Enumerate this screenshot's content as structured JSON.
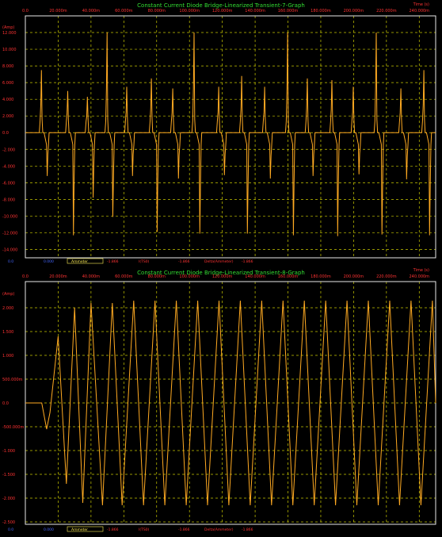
{
  "chart_data": [
    {
      "type": "line",
      "title": "Constant Current Diode Bridge-Linearized Transient-7-Graph",
      "xlabel": "Time (s)",
      "ylabel": "(Amp)",
      "x_ticks": [
        "0.0",
        "20.000m",
        "40.000m",
        "60.000m",
        "80.000m",
        "100.000m",
        "120.000m",
        "140.000m",
        "160.000m",
        "180.000m",
        "200.000m",
        "220.000m",
        "240.000m"
      ],
      "y_ticks": [
        "12.000",
        "10.000",
        "8.000",
        "6.000",
        "4.000",
        "2.000",
        "0.0",
        "-2.000",
        "-4.000",
        "-6.000",
        "-8.000",
        "-10.000",
        "-12.000",
        "-14.000"
      ],
      "ylim": [
        -15,
        14
      ],
      "xlim": [
        0,
        250
      ],
      "grid": true,
      "footer": {
        "left_value": "0.0",
        "x_readout": "0.000",
        "legend_box": "Ammeter",
        "readout1": "-1.866",
        "label2": "I(TS0)",
        "readout2": "-1.866",
        "label3": "Delta(Ammeter)",
        "readout3": "-1.866"
      },
      "series": [
        {
          "color": "#ffaa22",
          "spikes": [
            {
              "t": 10,
              "pos": 7.5,
              "neg": -5.2
            },
            {
              "t": 26,
              "pos": 5.0,
              "neg": -12.3
            },
            {
              "t": 38,
              "pos": 4.3,
              "neg": -7.8
            },
            {
              "t": 50,
              "pos": 12.0,
              "neg": -10.1
            },
            {
              "t": 62,
              "pos": 5.5,
              "neg": -5.2
            },
            {
              "t": 77,
              "pos": 6.5,
              "neg": -11.9
            },
            {
              "t": 90,
              "pos": 5.3,
              "neg": -5.5
            },
            {
              "t": 103,
              "pos": 12.0,
              "neg": -12.1
            },
            {
              "t": 118,
              "pos": 5.5,
              "neg": -5.1
            },
            {
              "t": 132,
              "pos": 6.8,
              "neg": -12.1
            },
            {
              "t": 146,
              "pos": 5.5,
              "neg": -5.5
            },
            {
              "t": 160,
              "pos": 12.0,
              "neg": -12.3
            },
            {
              "t": 172,
              "pos": 6.5,
              "neg": -5.2
            },
            {
              "t": 187,
              "pos": 6.3,
              "neg": -12.4
            },
            {
              "t": 200,
              "pos": 5.5,
              "neg": -5.0
            },
            {
              "t": 214,
              "pos": 12.0,
              "neg": -12.2
            },
            {
              "t": 229,
              "pos": 5.3,
              "neg": -5.6
            },
            {
              "t": 243,
              "pos": 7.5,
              "neg": -12.3
            }
          ]
        }
      ]
    },
    {
      "type": "line",
      "title": "Constant Current Diode Bridge-Linearized Transient-8-Graph",
      "xlabel": "Time (s)",
      "ylabel": "(Amp)",
      "x_ticks": [
        "0.0",
        "20.000m",
        "40.000m",
        "60.000m",
        "80.000m",
        "100.000m",
        "120.000m",
        "140.000m",
        "160.000m",
        "180.000m",
        "200.000m",
        "220.000m",
        "240.000m"
      ],
      "y_ticks": [
        "2.000",
        "1.500",
        "1.000",
        "500.000m",
        "0.0",
        "-500.000m",
        "-1.000",
        "-1.500",
        "-2.000",
        "-2.500"
      ],
      "ylim": [
        -2.55,
        2.55
      ],
      "xlim": [
        0,
        250
      ],
      "grid": true,
      "footer": {
        "left_value": "0.0",
        "x_readout": "0.000",
        "legend_box": "Ammeter",
        "readout1": "-1.866",
        "label2": "I(TS0)",
        "readout2": "-1.866",
        "label3": "Delta(Ammeter)",
        "readout3": "-1.866"
      },
      "series": [
        {
          "color": "#ffaa22",
          "description_points": [
            [
              0,
              0
            ],
            [
              10,
              0
            ],
            [
              13,
              -0.55
            ],
            [
              15,
              -0.2
            ],
            [
              20,
              1.4
            ],
            [
              25,
              -1.7
            ],
            [
              30,
              2.0
            ],
            [
              35,
              -2.1
            ],
            [
              40,
              2.1
            ],
            [
              47,
              -2.15
            ],
            [
              53,
              2.1
            ],
            [
              59,
              -2.15
            ],
            [
              66,
              2.15
            ],
            [
              72,
              -2.15
            ],
            [
              79,
              2.15
            ],
            [
              85,
              -2.15
            ],
            [
              92,
              2.15
            ],
            [
              98,
              -2.15
            ],
            [
              105,
              2.15
            ],
            [
              111,
              -2.15
            ],
            [
              118,
              2.15
            ],
            [
              124,
              -2.15
            ],
            [
              131,
              2.15
            ],
            [
              137,
              -2.15
            ],
            [
              144,
              2.15
            ],
            [
              150,
              -2.15
            ],
            [
              157,
              2.15
            ],
            [
              163,
              -2.15
            ],
            [
              170,
              2.15
            ],
            [
              176,
              -2.15
            ],
            [
              183,
              2.15
            ],
            [
              189,
              -2.15
            ],
            [
              196,
              2.15
            ],
            [
              202,
              -2.15
            ],
            [
              209,
              2.15
            ],
            [
              215,
              -2.15
            ],
            [
              222,
              2.15
            ],
            [
              228,
              -2.15
            ],
            [
              235,
              2.15
            ],
            [
              241,
              -2.15
            ],
            [
              248,
              2.15
            ],
            [
              250,
              0
            ]
          ]
        }
      ]
    }
  ]
}
